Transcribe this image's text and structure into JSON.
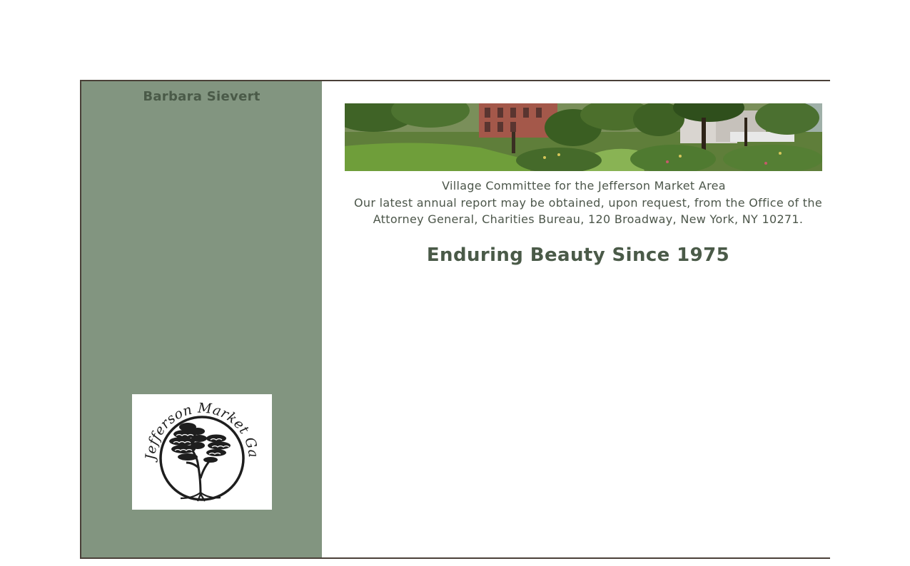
{
  "sidebar": {
    "name": "Barbara Sievert",
    "logo": {
      "alt": "The Jefferson Market Garden",
      "icon": "tree-seal-logo"
    }
  },
  "main": {
    "banner": {
      "icon": "garden-panorama-photo"
    },
    "org_name": "Village Committee for the Jefferson Market Area",
    "report_note_line1": "Our latest annual report may be obtained, upon request, from the Office of the",
    "report_note_line2": "Attorney General, Charities Bureau, 120 Broadway, New York, NY 10271.",
    "tagline": "Enduring Beauty Since 1975"
  },
  "colors": {
    "sidebar_bg": "#829580",
    "heading_text": "#4a5a48",
    "body_text": "#4c564a",
    "frame_border": "#4a4038"
  }
}
